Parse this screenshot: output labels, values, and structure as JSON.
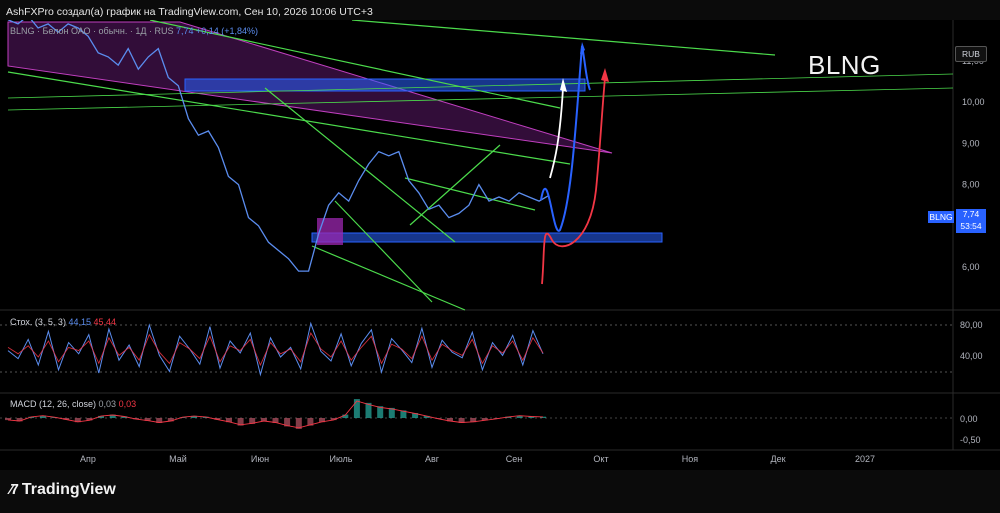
{
  "header": {
    "text": "AshFXPro создал(а) график на TradingView.com, Сен 10, 2026 10:06 UTC+3"
  },
  "ticker": "BLNG",
  "legend": {
    "symbol": "BLNG · Белон ОАО · обычн. · 1Д · RUS",
    "price": "7,74",
    "change": "+0,14 (+1,84%)"
  },
  "currency": "RUB",
  "last_price": {
    "symbol": "BLNG",
    "value": "7,74",
    "countdown": "53:54"
  },
  "stoch_legend": {
    "label": "Стох. (3, 5, 3)",
    "k": "44,15",
    "d": "45,44"
  },
  "macd_legend": {
    "label": "MACD (12, 26, close)",
    "macd": "0,03",
    "signal": "0,03"
  },
  "brand": {
    "name": "TradingView"
  },
  "colors": {
    "price_line": "#5b8def",
    "trendline": "#4cdb4c",
    "zone": "#2962ff",
    "wedge": "#9c27b0",
    "projection_red": "#f23645",
    "projection_white": "#ffffff"
  },
  "chart_data": [
    {
      "type": "line",
      "title": "BLNG",
      "x_labels": [
        "Апр",
        "Май",
        "Июн",
        "Июль",
        "Авг",
        "Сен",
        "Окт",
        "Ноя",
        "Дек",
        "2027"
      ],
      "y_ticks": [
        "11,00",
        "10,00",
        "9,00",
        "8,00",
        "7,00",
        "6,00"
      ],
      "ylim": [
        5.0,
        12.0
      ],
      "series": [
        {
          "x": [
            0.0,
            0.1,
            0.2,
            0.3,
            0.4,
            0.5,
            0.6,
            0.7,
            0.8,
            0.9,
            1.0,
            1.1,
            1.2,
            1.3,
            1.4,
            1.5,
            1.6,
            1.7,
            1.8,
            1.9,
            2.0,
            2.1,
            2.2,
            2.3,
            2.4,
            2.5,
            2.6,
            2.7,
            2.8,
            2.9,
            3.0,
            3.1,
            3.2,
            3.3,
            3.4,
            3.5,
            3.6,
            3.7,
            3.8,
            3.9,
            4.0,
            4.1,
            4.2,
            4.3,
            4.4,
            4.5,
            4.6,
            4.7,
            4.8,
            4.9,
            5.0,
            5.1,
            5.2,
            5.3,
            5.4
          ],
          "values": [
            12.0,
            11.9,
            12.1,
            11.8,
            11.9,
            11.7,
            11.9,
            11.8,
            11.6,
            11.2,
            11.1,
            10.9,
            11.3,
            10.8,
            11.1,
            11.3,
            10.6,
            10.4,
            9.6,
            9.2,
            9.3,
            8.9,
            8.2,
            8.0,
            7.2,
            7.0,
            6.6,
            6.4,
            6.2,
            5.9,
            5.9,
            6.8,
            7.5,
            7.8,
            7.6,
            8.1,
            8.5,
            8.8,
            8.7,
            8.8,
            8.1,
            7.8,
            7.4,
            7.5,
            7.2,
            7.3,
            7.5,
            8.0,
            7.6,
            7.7,
            7.6,
            7.8,
            7.7,
            7.6,
            7.74
          ]
        }
      ]
    },
    {
      "type": "line",
      "title": "Стох. (3, 5, 3)",
      "y_ticks": [
        "80,00",
        "40,00"
      ],
      "ylim": [
        0,
        100
      ],
      "series": [
        {
          "name": "%K",
          "values": [
            48,
            38,
            62,
            30,
            72,
            24,
            58,
            44,
            68,
            20,
            75,
            36,
            55,
            28,
            80,
            42,
            22,
            66,
            50,
            31,
            78,
            26,
            60,
            45,
            70,
            18,
            64,
            40,
            52,
            25,
            82,
            47,
            35,
            69,
            29,
            57,
            74,
            21,
            63,
            49,
            33,
            76,
            27,
            61,
            46,
            39,
            71,
            24,
            58,
            42,
            67,
            30,
            73,
            44
          ]
        },
        {
          "name": "%D",
          "values": [
            52,
            44,
            54,
            40,
            60,
            34,
            52,
            48,
            60,
            32,
            64,
            42,
            52,
            36,
            68,
            46,
            32,
            58,
            50,
            38,
            66,
            34,
            54,
            48,
            62,
            30,
            58,
            44,
            50,
            34,
            70,
            50,
            40,
            60,
            36,
            52,
            66,
            32,
            56,
            50,
            38,
            66,
            36,
            56,
            48,
            42,
            62,
            32,
            54,
            45,
            60,
            36,
            64,
            45
          ]
        }
      ]
    },
    {
      "type": "bar",
      "title": "MACD (12, 26, close)",
      "y_ticks": [
        "0,00",
        "-0,50"
      ],
      "ylim": [
        -0.8,
        0.6
      ],
      "values": [
        -0.05,
        -0.08,
        0.03,
        0.06,
        0.02,
        -0.04,
        -0.1,
        -0.06,
        0.05,
        0.08,
        0.04,
        -0.03,
        -0.07,
        -0.12,
        -0.08,
        0.02,
        0.05,
        0.03,
        -0.04,
        -0.1,
        -0.18,
        -0.14,
        -0.08,
        -0.12,
        -0.2,
        -0.26,
        -0.18,
        -0.1,
        -0.05,
        0.08,
        0.45,
        0.36,
        0.28,
        0.24,
        0.18,
        0.12,
        0.05,
        -0.02,
        -0.08,
        -0.12,
        -0.1,
        -0.06,
        -0.02,
        0.03,
        0.06,
        0.04,
        0.03
      ]
    }
  ]
}
